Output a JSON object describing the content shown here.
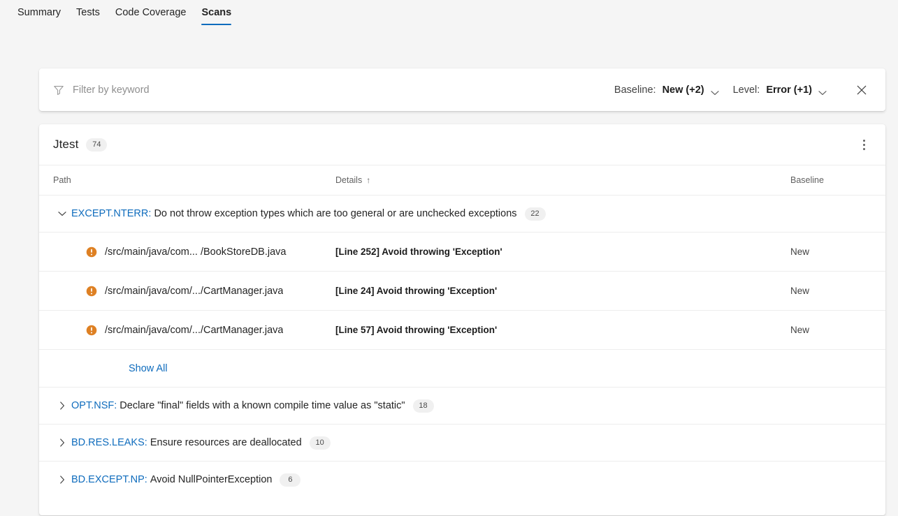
{
  "tabs": [
    {
      "label": "Summary",
      "active": false
    },
    {
      "label": "Tests",
      "active": false
    },
    {
      "label": "Code Coverage",
      "active": false
    },
    {
      "label": "Scans",
      "active": true
    }
  ],
  "filter_bar": {
    "funnel_icon": "filter-funnel-icon",
    "keyword_value": "",
    "keyword_placeholder": "Filter by keyword",
    "baseline_label": "Baseline:",
    "baseline_value": "New (+2)",
    "level_label": "Level:",
    "level_value": "Error (+1)",
    "chevron_icon": "chevron-down-icon",
    "close_icon": "close-icon"
  },
  "results": {
    "tool_name": "Jtest",
    "tool_count": "74",
    "overflow_icon": "more-vertical-icon",
    "columns": {
      "path": "Path",
      "details": "Details",
      "details_sort": "↑",
      "baseline": "Baseline"
    },
    "groups": [
      {
        "expanded": true,
        "twisty_icon": "chevron-down-icon",
        "rule_id": "EXCEPT.NTERR:",
        "rule_desc": "Do not throw exception types which are too general or are unchecked exceptions",
        "count": "22",
        "items": [
          {
            "severity_icon": "error-circle-icon",
            "path": "/src/main/java/com... /BookStoreDB.java",
            "details": "[Line 252] Avoid throwing 'Exception'",
            "baseline": "New"
          },
          {
            "severity_icon": "error-circle-icon",
            "path": "/src/main/java/com/.../CartManager.java",
            "details": "[Line 24] Avoid throwing 'Exception'",
            "baseline": "New"
          },
          {
            "severity_icon": "error-circle-icon",
            "path": "/src/main/java/com/.../CartManager.java",
            "details": "[Line 57] Avoid throwing 'Exception'",
            "baseline": "New"
          }
        ],
        "show_all_label": "Show All"
      },
      {
        "expanded": false,
        "twisty_icon": "chevron-right-icon",
        "rule_id": "OPT.NSF:",
        "rule_desc": "Declare \"final\" fields with a known compile time value as \"static\"",
        "count": "18",
        "items": [],
        "show_all_label": ""
      },
      {
        "expanded": false,
        "twisty_icon": "chevron-right-icon",
        "rule_id": "BD.RES.LEAKS:",
        "rule_desc": "Ensure resources are deallocated",
        "count": "10",
        "items": [],
        "show_all_label": ""
      },
      {
        "expanded": false,
        "twisty_icon": "chevron-right-icon",
        "rule_id": "BD.EXCEPT.NP:",
        "rule_desc": "Avoid NullPointerException",
        "count": "6",
        "items": [],
        "show_all_label": ""
      }
    ]
  },
  "colors": {
    "accent": "#0f6cbd",
    "severity_error": "#d97706",
    "page_background": "#f5f5f5",
    "card_background": "#ffffff",
    "badge_background": "#f0f0f0"
  }
}
